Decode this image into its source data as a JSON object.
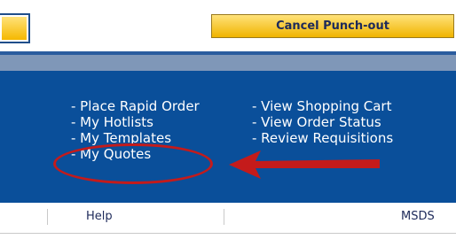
{
  "header": {
    "cancel_button_label": "Cancel Punch-out",
    "accent_color": "#f5b800",
    "panel_color": "#0a4f9a"
  },
  "menu": {
    "left_links": [
      {
        "label": "- Place Rapid Order"
      },
      {
        "label": "- My Hotlists"
      },
      {
        "label": "- My Templates"
      },
      {
        "label": "- My Quotes"
      }
    ],
    "right_links": [
      {
        "label": "- View Shopping Cart"
      },
      {
        "label": "- View Order Status"
      },
      {
        "label": "- Review Requisitions"
      }
    ],
    "annotation_color": "#c41b1b"
  },
  "footer": {
    "help_label": "Help",
    "msds_label": "MSDS"
  }
}
